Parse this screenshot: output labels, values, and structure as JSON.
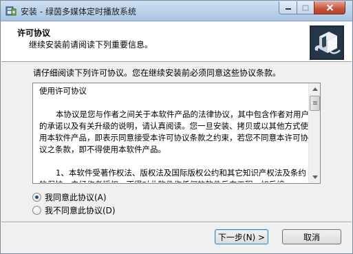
{
  "window": {
    "title": "安装 - 绿茵多媒体定时播放系统"
  },
  "header": {
    "title": "许可协议",
    "subtitle": "继续安装前请阅读下列重要信息。"
  },
  "instruction": "请仔细阅读下列许可协议。您在继续安装前必须同意这些协议条款。",
  "license": {
    "heading": "使用许可协议",
    "paragraph1": "本协议是您与作者之间关于本软件产品的法律协议，其中包含作者对用户的承诺以及有关升级的说明，请认真阅读。您一旦安装、拷贝或以其他方式使用本软件产品，即表示同意接受本许可协议条款之约束，若您不同意本许可协议之条款，即不得使用本软件产品。",
    "paragraph2": "1、本软件受著作权法、版权法及国际版权公约和其它知识产权法及条约的保护，未经作者授权，不得对此软件作任何的软件反向工程，如反编"
  },
  "options": {
    "accept_label": "我同意此协议(A)",
    "decline_label": "我不同意此协议(D)",
    "selected": "accept"
  },
  "buttons": {
    "next_label": "下一步(N) >",
    "cancel_label": "取消"
  }
}
